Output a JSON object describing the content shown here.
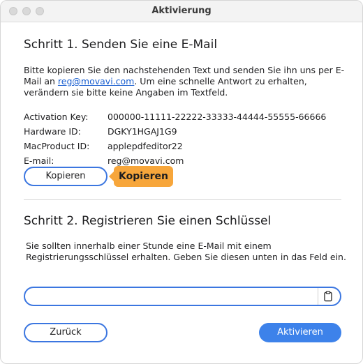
{
  "window": {
    "title": "Aktivierung"
  },
  "step1": {
    "heading": "Schritt 1. Senden Sie eine E-Mail",
    "instruction_part1": "Bitte kopieren Sie den nachstehenden Text und senden Sie ihn uns per E-Mail an ",
    "email_link": "reg@movavi.com",
    "instruction_part2": ". Um eine schnelle Antwort zu erhalten, verändern sie bitte keine Angaben im Textfeld.",
    "fields": [
      {
        "label": "Activation Key:",
        "value": "000000-11111-22222-33333-44444-55555-66666"
      },
      {
        "label": "Hardware ID:",
        "value": "DGKY1HGAJ1G9"
      },
      {
        "label": "MacProduct ID:",
        "value": "applepdfeditor22"
      },
      {
        "label": "E-mail:",
        "value": "reg@movavi.com"
      }
    ],
    "copy_button": "Kopieren",
    "tooltip": "Kopieren"
  },
  "step2": {
    "heading": "Schritt 2. Registrieren Sie einen Schlüssel",
    "instruction": "Sie sollten innerhalb einer Stunde eine E-Mail mit einem Registrierungsschlüssel erhalten. Geben Sie diesen unten in das Feld ein.",
    "key_input_value": "",
    "paste_icon": "clipboard-paste-icon"
  },
  "buttons": {
    "back": "Zurück",
    "activate": "Aktivieren"
  },
  "colors": {
    "accent": "#3d82ea",
    "tooltip": "#f7a63b",
    "link": "#1a5fd0"
  }
}
